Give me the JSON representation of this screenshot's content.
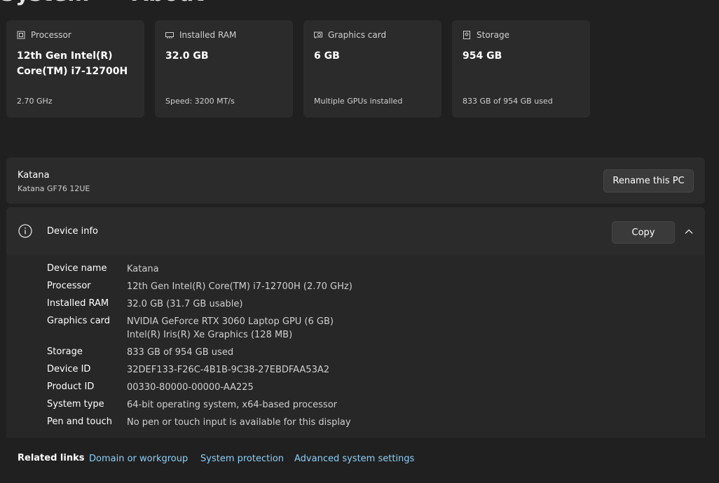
{
  "page": {
    "breadcrumb_parent": "System",
    "breadcrumb_current": "About"
  },
  "cards": [
    {
      "label": "Processor",
      "icon": "processor-icon",
      "value": "12th Gen Intel(R) Core(TM) i7-12700H",
      "sub": "2.70 GHz"
    },
    {
      "label": "Installed RAM",
      "icon": "ram-icon",
      "value": "32.0 GB",
      "sub": "Speed: 3200 MT/s"
    },
    {
      "label": "Graphics card",
      "icon": "graphics-card-icon",
      "value": "6 GB",
      "sub": "Multiple GPUs installed"
    },
    {
      "label": "Storage",
      "icon": "storage-icon",
      "value": "954 GB",
      "sub": "833 GB of 954 GB used"
    }
  ],
  "pc": {
    "name": "Katana",
    "model": "Katana GF76 12UE",
    "rename_label": "Rename this PC"
  },
  "device_info": {
    "title": "Device info",
    "copy_label": "Copy",
    "specs": [
      {
        "label": "Device name",
        "value": "Katana"
      },
      {
        "label": "Processor",
        "value": "12th Gen Intel(R) Core(TM) i7-12700H (2.70 GHz)"
      },
      {
        "label": "Installed RAM",
        "value": "32.0 GB (31.7 GB usable)"
      },
      {
        "label": "Graphics card",
        "value": "NVIDIA GeForce RTX 3060 Laptop GPU (6 GB)",
        "value2": "Intel(R) Iris(R) Xe Graphics (128 MB)"
      },
      {
        "label": "Storage",
        "value": "833 GB of 954 GB used"
      },
      {
        "label": "Device ID",
        "value": "32DEF133-F26C-4B1B-9C38-27EBDFAA53A2"
      },
      {
        "label": "Product ID",
        "value": "00330-80000-00000-AA225"
      },
      {
        "label": "System type",
        "value": "64-bit operating system, x64-based processor"
      },
      {
        "label": "Pen and touch",
        "value": "No pen or touch input is available for this display"
      }
    ]
  },
  "related_links": {
    "label": "Related links",
    "links": [
      "Domain or workgroup",
      "System protection",
      "Advanced system settings"
    ]
  },
  "colors": {
    "background": "#202020",
    "card": "#2b2b2b",
    "link": "#8ccff8"
  }
}
